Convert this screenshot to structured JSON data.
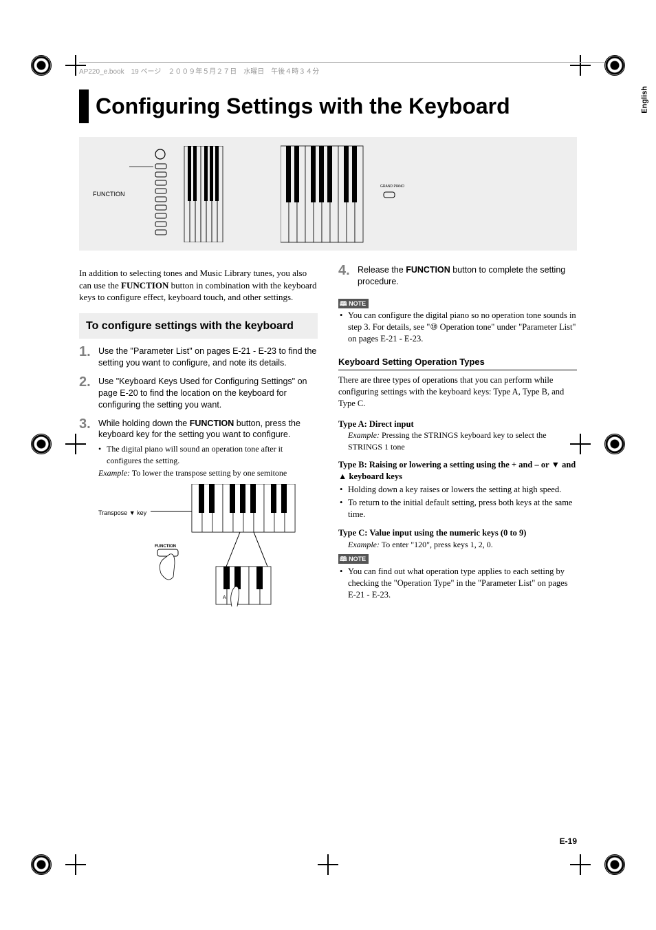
{
  "header_text": "AP220_e.book　19 ページ　２００９年５月２７日　水曜日　午後４時３４分",
  "lang_tab": "English",
  "title": "Configuring Settings with the Keyboard",
  "diagram": {
    "function_label": "FUNCTION"
  },
  "intro": "In addition to selecting tones and Music Library tunes, you also can use the FUNCTION button in combination with the keyboard keys to configure effect, keyboard touch, and other settings.",
  "section_header": "To configure settings with the keyboard",
  "steps": {
    "s1": "Use the \"Parameter List\" on pages E-21 - E-23 to find the setting you want to configure, and note its details.",
    "s2": "Use \"Keyboard Keys Used for Configuring Settings\" on page E-20 to find the location on the keyboard for configuring the setting you want.",
    "s3": "While holding down the FUNCTION button, press the keyboard key for the setting you want to configure.",
    "s3_bullet": "The digital piano will sound an operation tone after it configures the setting.",
    "s3_example_label": "Example:",
    "s3_example": "To lower the transpose setting by one semitone",
    "s3_diagram_label": "Transpose ▼ key",
    "s4": "Release the FUNCTION button to complete the setting procedure."
  },
  "note1_badge": "NOTE",
  "note1_bullet": "You can configure the digital piano so no operation tone sounds in step 3. For details, see \"⑩ Operation tone\" under \"Parameter List\" on pages E-21 - E-23.",
  "subhead": "Keyboard Setting Operation Types",
  "types_intro": "There are three types of operations that you can perform while configuring settings with the keyboard keys: Type A, Type B, and Type C.",
  "typeA_head": "Type A: Direct input",
  "typeA_example_label": "Example:",
  "typeA_example": "Pressing the STRINGS keyboard key to select the STRINGS 1 tone",
  "typeB_head": "Type B: Raising or lowering a setting using the + and – or ▼ and ▲ keyboard keys",
  "typeB_b1": "Holding down a key raises or lowers the setting at high speed.",
  "typeB_b2": "To return to the initial default setting, press both keys at the same time.",
  "typeC_head": "Type C: Value input using the numeric keys (0 to 9)",
  "typeC_example_label": "Example:",
  "typeC_example": "To enter \"120\", press keys 1, 2, 0.",
  "note2_badge": "NOTE",
  "note2_bullet": "You can find out what operation type applies to each setting by checking the \"Operation Type\" in the \"Parameter List\" on pages E-21 - E-23.",
  "page_num": "E-19"
}
